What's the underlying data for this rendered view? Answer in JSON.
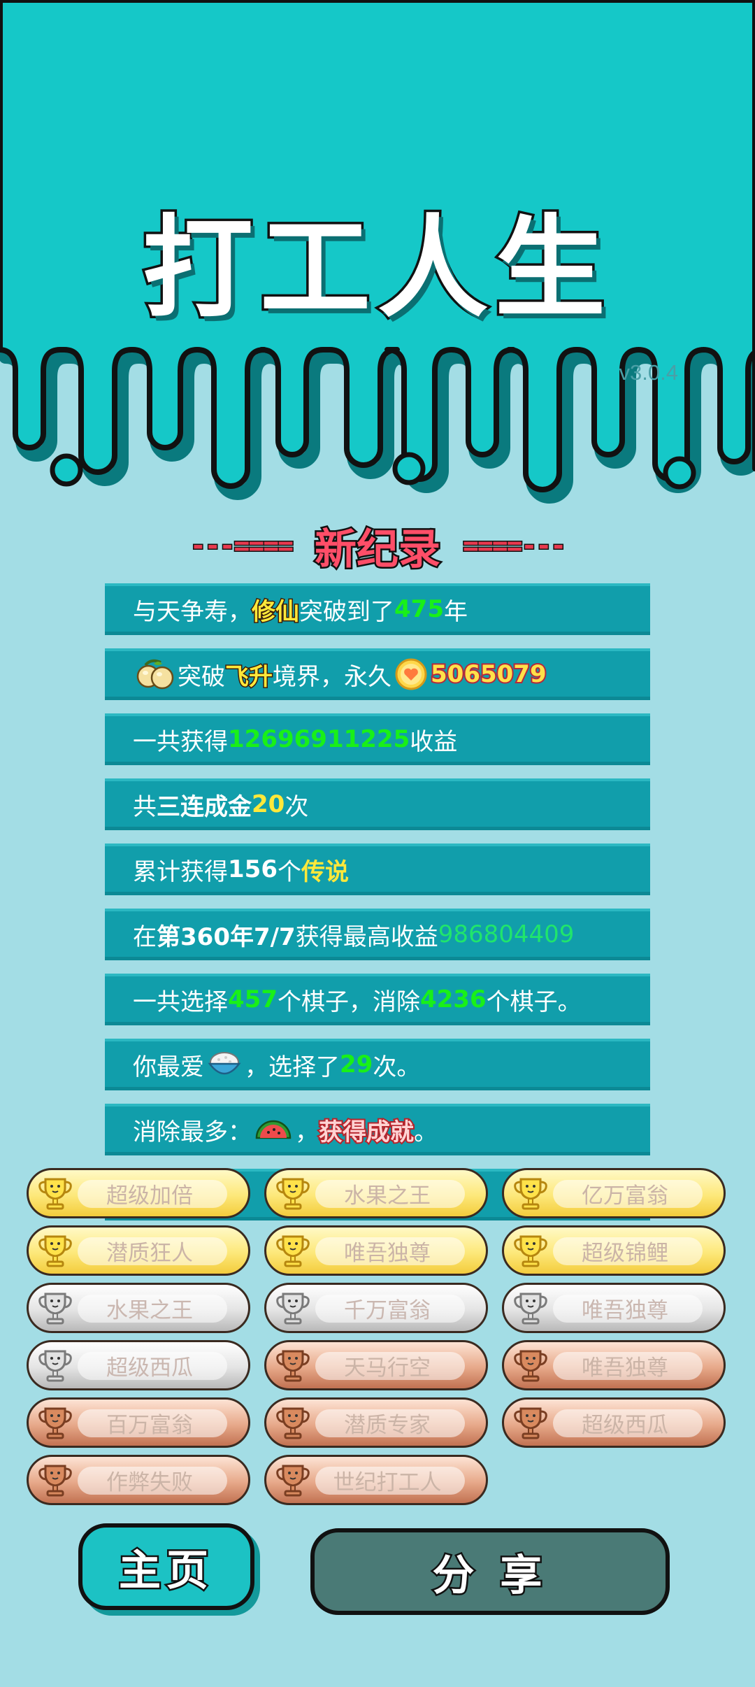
{
  "app": {
    "title": "打工人生",
    "version": "v3.0.4"
  },
  "record": {
    "heading": "新纪录",
    "deco_left": "---====",
    "deco_right": "====---"
  },
  "stats": [
    {
      "parts": [
        "与天争寿，",
        "修仙",
        "突破到了",
        "475",
        "年"
      ]
    },
    {
      "parts": [
        "突破",
        "飞升",
        "境界，永久",
        "5065079"
      ],
      "icon": "peach-icon",
      "coin_icon": "heart-coin-icon"
    },
    {
      "parts": [
        "一共获得",
        "12696911225",
        "收益"
      ]
    },
    {
      "parts": [
        "共",
        "三连成金",
        "20",
        "次"
      ]
    },
    {
      "parts": [
        "累计获得",
        "156",
        "个",
        "传说"
      ]
    },
    {
      "parts": [
        "在 ",
        "第360年7/7",
        " 获得最高收益",
        "986804409"
      ]
    },
    {
      "parts": [
        "一共选择",
        "457",
        "个棋子，消除",
        "4236",
        "个棋子。"
      ]
    },
    {
      "parts": [
        "你最爱",
        "，选择了",
        "29",
        "次。"
      ],
      "icon": "rice-bowl-icon"
    },
    {
      "parts": [
        "消除最多：",
        "，",
        "获得成就",
        "。"
      ],
      "icon": "watermelon-icon"
    }
  ],
  "achievements": [
    {
      "label": "超级加倍",
      "tier": "gold"
    },
    {
      "label": "水果之王",
      "tier": "gold"
    },
    {
      "label": "亿万富翁",
      "tier": "gold"
    },
    {
      "label": "潜质狂人",
      "tier": "gold"
    },
    {
      "label": "唯吾独尊",
      "tier": "gold"
    },
    {
      "label": "超级锦鲤",
      "tier": "gold"
    },
    {
      "label": "水果之王",
      "tier": "silver"
    },
    {
      "label": "千万富翁",
      "tier": "silver"
    },
    {
      "label": "唯吾独尊",
      "tier": "silver"
    },
    {
      "label": "超级西瓜",
      "tier": "silver"
    },
    {
      "label": "天马行空",
      "tier": "bronze"
    },
    {
      "label": "唯吾独尊",
      "tier": "bronze"
    },
    {
      "label": "百万富翁",
      "tier": "bronze"
    },
    {
      "label": "潜质专家",
      "tier": "bronze"
    },
    {
      "label": "超级西瓜",
      "tier": "bronze"
    },
    {
      "label": "作弊失败",
      "tier": "bronze"
    },
    {
      "label": "世纪打工人",
      "tier": "bronze"
    }
  ],
  "buttons": {
    "home": "主页",
    "share": "分 享"
  },
  "colors": {
    "header": "#15c8c8",
    "background": "#a3dde5",
    "row": "#119eab",
    "gold": "#fde87a",
    "silver": "#e4e4e4",
    "bronze": "#e7a98a",
    "home_button": "#1cc2c4",
    "share_button": "#4a7a76"
  }
}
